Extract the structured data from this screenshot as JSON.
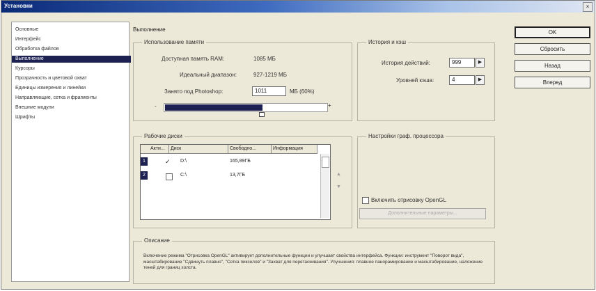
{
  "window": {
    "title": "Установки",
    "close_glyph": "×"
  },
  "sidebar": {
    "items": [
      {
        "label": "Основные",
        "selected": false
      },
      {
        "label": "Интерфейс",
        "selected": false
      },
      {
        "label": "Обработка файлов",
        "selected": false
      },
      {
        "label": "Выполнение",
        "selected": true
      },
      {
        "label": "Курсоры",
        "selected": false
      },
      {
        "label": "Прозрачность и цветовой охват",
        "selected": false
      },
      {
        "label": "Единицы измерения и линейки",
        "selected": false
      },
      {
        "label": "Направляющие, сетка и фрагменты",
        "selected": false
      },
      {
        "label": "Внешние модули",
        "selected": false
      },
      {
        "label": "Шрифты",
        "selected": false
      }
    ]
  },
  "main_title": "Выполнение",
  "memory": {
    "legend": "Использование памяти",
    "available_label": "Доступная память RAM:",
    "available_value": "1085 МБ",
    "ideal_label": "Идеальный диапазон:",
    "ideal_value": "927-1219 МБ",
    "photoshop_label": "Занято под Photoshop:",
    "photoshop_value": "1011",
    "photoshop_suffix": "МБ (60%)",
    "minus": "-",
    "plus": "+",
    "slider_fraction": 0.6
  },
  "history": {
    "legend": "История и кэш",
    "states_label": "История действий:",
    "states_value": "999",
    "cache_label": "Уровней кэша:",
    "cache_value": "4",
    "spin_glyph": "▶"
  },
  "buttons": {
    "ok": "OK",
    "reset": "Сбросить",
    "prev": "Назад",
    "next": "Вперед"
  },
  "scratch": {
    "legend": "Рабочие диски",
    "headers": [
      "Акти...",
      "Диск",
      "Свободно...",
      "Информация"
    ],
    "rows": [
      {
        "no": "1",
        "active": true,
        "drive": "D:\\",
        "free": "165,89ГБ",
        "info": ""
      },
      {
        "no": "2",
        "active": false,
        "drive": "C:\\",
        "free": "13,7ГБ",
        "info": ""
      }
    ],
    "up_glyph": "▲",
    "down_glyph": "▼"
  },
  "gpu": {
    "legend": "Настройки граф. процессора",
    "opengl_label": "Включить отрисовку OpenGL",
    "advanced_label": "Дополнительные параметры..."
  },
  "description": {
    "legend": "Описание",
    "text": "Включение режима \"Отрисовка OpenGL\" активирует дополнительные функции и улучшает свойства интерфейса. Функции: инструмент \"Поворот вида\", масштабирование \"Сдвинуть плавно\", \"Сетка пикселов\" и \"Захват для перетаскивания\". Улучшения: плавное панорамирование и масштабирование, наложение теней для границ холста."
  },
  "colors": {
    "accent": "#1d2152",
    "title_start": "#0b2a78",
    "face": "#ece9d8"
  }
}
